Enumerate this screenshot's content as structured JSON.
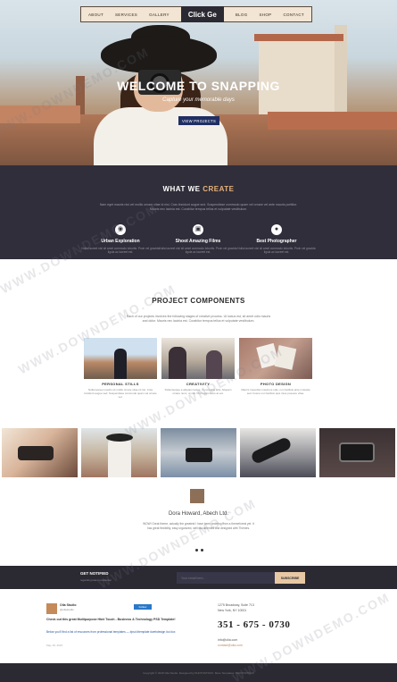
{
  "nav": {
    "left": [
      "ABOUT",
      "SERVICES",
      "GALLERY"
    ],
    "logo": "Click Ge",
    "right": [
      "BLOG",
      "SHOP",
      "CONTACT"
    ]
  },
  "hero": {
    "title": "WELCOME TO SNAPPING",
    "subtitle": "Capture your memorable days",
    "button": "VIEW PROJECTS"
  },
  "create": {
    "title_prefix": "WHAT WE",
    "title_accent": "CREATE",
    "description": "Nam eget mauris nisi vel mollis ornare vitae id nisi. Cras tincidunt augue sed. Suspendisse commodo quam vel ornare vel ante mauris porttitor. Mauris nec lacinia est. Curabitur tempus tellus et vulputate vestibulum.",
    "features": [
      {
        "icon": "camera-icon",
        "title": "Urban Exploration",
        "text": "Nulla laoreet nisl sit amet commodo lobortis. Proin vel gravida ligula ac laoreet est."
      },
      {
        "icon": "film-icon",
        "title": "Shoot Amazing Films",
        "text": "Nulla laoreet nisl sit amet commodo lobortis. Proin vel gravida ligula ac laoreet est."
      },
      {
        "icon": "user-icon",
        "title": "Best Photographer",
        "text": "Nulla laoreet nisl sit amet commodo lobortis. Proin vel gravida ligula ac laoreet est."
      }
    ]
  },
  "projects": {
    "title": "PROJECT COMPONENTS",
    "description": "Each of our projects involves the following stages of creative process. Ut luctus est, sit amet odio mauris and dolor. Mauris nec lacinia est. Curabitur tempus tellus et vulputate vestibulum.",
    "cards": [
      {
        "title": "PERSONAL STILLS",
        "text": "Nulla laoreet mauris sit mollis ornare vitae id nisi. Cras tincidunt augue sed. Suspendisse commodo quam vel ornare vel."
      },
      {
        "title": "CREATIVITY",
        "text": "Pellentesque a aliquam lectus. In convallis felis. Aliquam ornare nunc, ut nisl. Proin quis lacus at est."
      },
      {
        "title": "PHOTO DESIGN",
        "text": "Mauris imperdiet maximus odio, non facilisis ante molestie sed. Fusce non facilisis quis risus posuere vitae."
      }
    ]
  },
  "testimonial": {
    "name": "Dora Howard, Abech Ltd.",
    "text": "WOW! Great theme, actually the greatest I have been ordering from a themeforest yet. It has great flexibility, easy organized, well documented and designed with Themes."
  },
  "newsletter": {
    "title": "GET NOTIFIED",
    "subtitle": "regarding latest newsletter",
    "placeholder": "Your email here...",
    "button": "SUBSCRIBE"
  },
  "footer": {
    "tweet_name": "Olia Studio",
    "tweet_handle": "@oliastudio",
    "follow": "Follow",
    "tweet_text": "Check out this great Multipurpose Html Touch - Business & Technology PSD Template!",
    "tweet_link": "Below you'll find a list of resources from professional templates — #psd #template #webdesign #ui #ux",
    "tweet_date": "May 18, 2015",
    "address1": "1275 Broadway, Suite 713",
    "address2": "New York, NY 10001",
    "phone": "351 - 675 - 0730",
    "email1": "info@olia.com",
    "email2": "contact@olia.com",
    "copyright": "Copyright © 2015 Olia Studio. Designed by PHOTOSTOCK. More Templates: PHOTOSTOCK"
  },
  "watermark": "WWW.DOWNDEMO.COM"
}
